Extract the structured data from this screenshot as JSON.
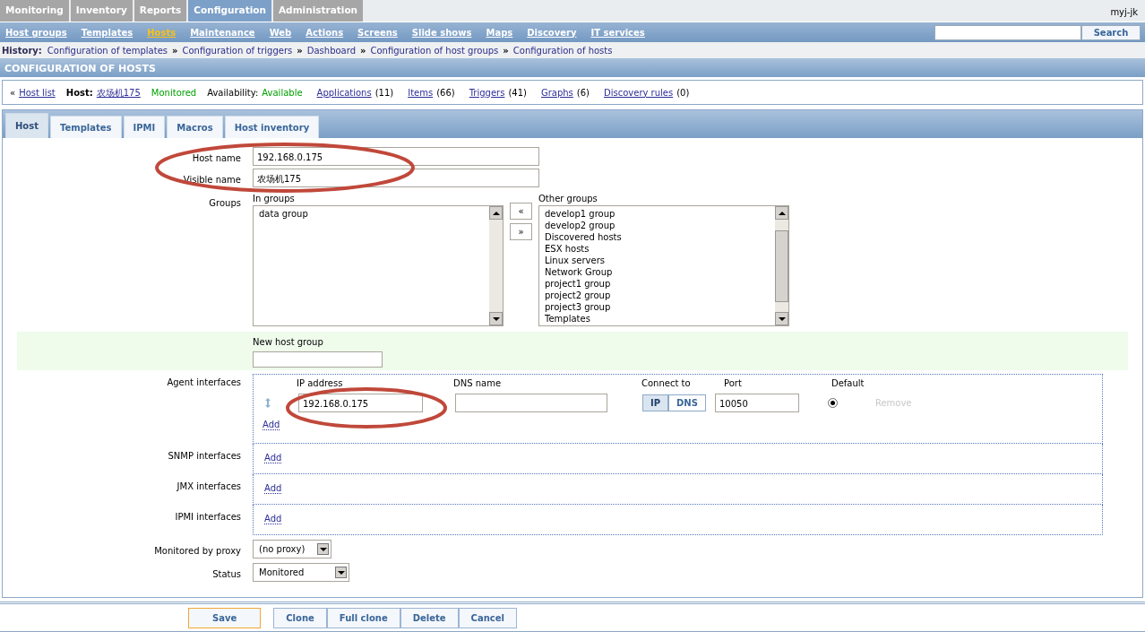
{
  "main_menu": [
    {
      "label": "Monitoring",
      "selected": false
    },
    {
      "label": "Inventory",
      "selected": false
    },
    {
      "label": "Reports",
      "selected": false
    },
    {
      "label": "Configuration",
      "selected": true
    },
    {
      "label": "Administration",
      "selected": false
    }
  ],
  "user": "myj-jk",
  "sub_menu": [
    {
      "label": "Host groups",
      "selected": false
    },
    {
      "label": "Templates",
      "selected": false
    },
    {
      "label": "Hosts",
      "selected": true
    },
    {
      "label": "Maintenance",
      "selected": false
    },
    {
      "label": "Web",
      "selected": false
    },
    {
      "label": "Actions",
      "selected": false
    },
    {
      "label": "Screens",
      "selected": false
    },
    {
      "label": "Slide shows",
      "selected": false
    },
    {
      "label": "Maps",
      "selected": false
    },
    {
      "label": "Discovery",
      "selected": false
    },
    {
      "label": "IT services",
      "selected": false
    }
  ],
  "search": {
    "button": "Search"
  },
  "history": {
    "label": "History:",
    "items": [
      "Configuration of templates",
      "Configuration of triggers",
      "Dashboard",
      "Configuration of host groups",
      "Configuration of hosts"
    ],
    "separator": "»"
  },
  "page_title": "CONFIGURATION OF HOSTS",
  "host_bar": {
    "back": "«",
    "host_list": "Host list",
    "host_label": "Host:",
    "host_name": "农场机175",
    "status": "Monitored",
    "availability_label": "Availability:",
    "availability": "Available",
    "links": [
      {
        "label": "Applications",
        "count": "(11)"
      },
      {
        "label": "Items",
        "count": "(66)"
      },
      {
        "label": "Triggers",
        "count": "(41)"
      },
      {
        "label": "Graphs",
        "count": "(6)"
      },
      {
        "label": "Discovery rules",
        "count": "(0)"
      }
    ]
  },
  "tabs": [
    {
      "label": "Host",
      "selected": true
    },
    {
      "label": "Templates",
      "selected": false
    },
    {
      "label": "IPMI",
      "selected": false
    },
    {
      "label": "Macros",
      "selected": false
    },
    {
      "label": "Host inventory",
      "selected": false
    }
  ],
  "form": {
    "host_name": {
      "label": "Host name",
      "value": "192.168.0.175"
    },
    "visible_name": {
      "label": "Visible name",
      "value": "农场机175"
    },
    "groups": {
      "label": "Groups",
      "in_label": "In groups",
      "in_groups": [
        "data group"
      ],
      "other_label": "Other groups",
      "other_groups": [
        "develop1 group",
        "develop2 group",
        "Discovered hosts",
        "ESX hosts",
        "Linux servers",
        "Network Group",
        "project1 group",
        "project2 group",
        "project3 group",
        "Templates"
      ],
      "move_left": "«",
      "move_right": "»"
    },
    "new_group": {
      "label": "New host group"
    },
    "agent": {
      "label": "Agent interfaces",
      "headers": [
        "IP address",
        "DNS name",
        "Connect to",
        "Port",
        "Default"
      ],
      "ip": "192.168.0.175",
      "connect": [
        {
          "label": "IP",
          "selected": true
        },
        {
          "label": "DNS",
          "selected": false
        }
      ],
      "port": "10050",
      "default_checked": true,
      "remove": "Remove",
      "remove_disabled": true,
      "add": "Add"
    },
    "other_interfaces": [
      {
        "label": "SNMP interfaces",
        "add": "Add"
      },
      {
        "label": "JMX interfaces",
        "add": "Add"
      },
      {
        "label": "IPMI interfaces",
        "add": "Add"
      }
    ],
    "proxy": {
      "label": "Monitored by proxy",
      "value": "(no proxy)"
    },
    "status": {
      "label": "Status",
      "value": "Monitored"
    }
  },
  "buttons": [
    {
      "label": "Save",
      "kind": "primary"
    },
    {
      "label": "Clone",
      "kind": "group"
    },
    {
      "label": "Full clone",
      "kind": "group"
    },
    {
      "label": "Delete",
      "kind": "group"
    },
    {
      "label": "Cancel",
      "kind": "group"
    }
  ]
}
